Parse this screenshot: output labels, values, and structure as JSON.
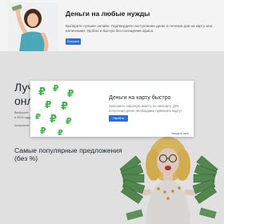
{
  "notification": {
    "title": "Деньги на любые нужды",
    "body": "Выберите лучшее онлайн. Подтвердите поступление денег в течение дня на карту или наличными. Удобно и быстро без посещения офиса.",
    "button_label": "Получить"
  },
  "page": {
    "heading_line1": "Луч",
    "heading_line2": "онл",
    "sub_line1": "Выберите",
    "sub_line2": "в 2024 году",
    "sub_line3": "получение",
    "section_heading": "Самые популярные предложения (без %)"
  },
  "modal": {
    "title": "Деньги на карту быстро",
    "body": "Заполните короткую анкету по паспорту. Для получения денег необходимо привязать карту!",
    "button_label": "Перейти",
    "close_label": "Закрыть окно"
  },
  "colors": {
    "accent": "#2c6fdc",
    "money_green": "#3fb84a"
  }
}
